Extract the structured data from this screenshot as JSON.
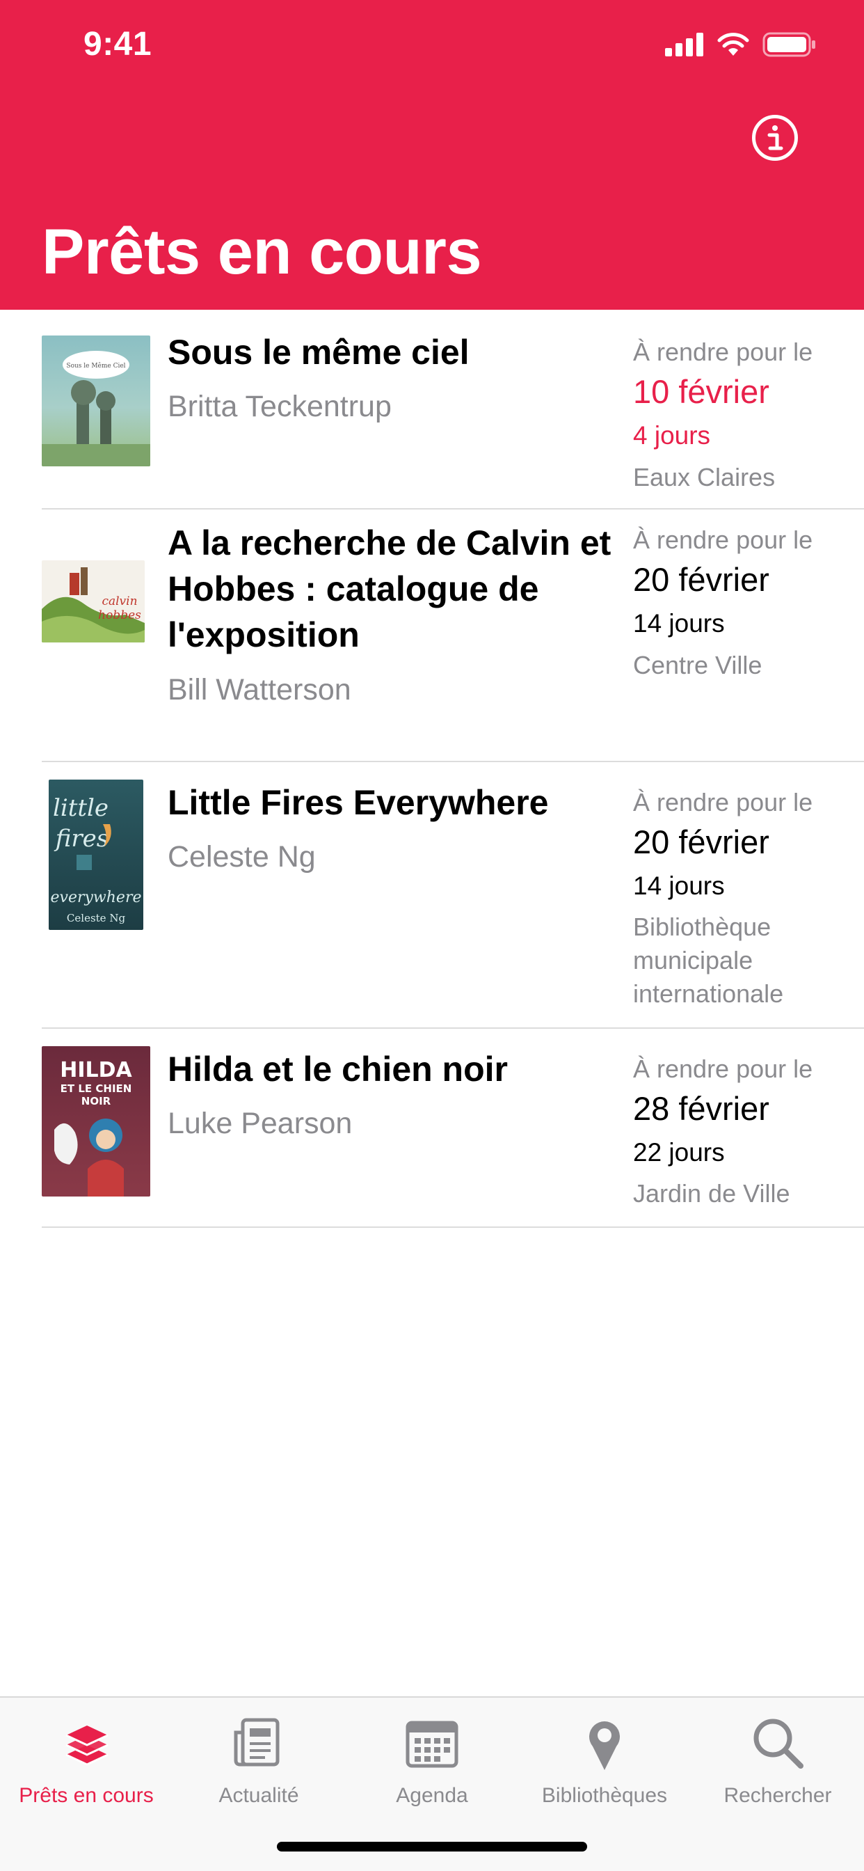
{
  "status_bar": {
    "time": "9:41"
  },
  "header": {
    "title": "Prêts en cours",
    "info_icon": "info-circle-icon"
  },
  "colors": {
    "accent": "#E8204A",
    "secondary_text": "#8a8a8e"
  },
  "loans": [
    {
      "title": "Sous le même ciel",
      "author": "Britta Teckentrup",
      "due_label": "À rendre pour le",
      "due_date": "10 février",
      "days_left": "4 jours",
      "library": "Eaux Claires",
      "urgent": true,
      "cover_text": "Sous le Même Ciel"
    },
    {
      "title": "A la recherche de Calvin et Hobbes : catalogue de l'exposition",
      "author": "Bill Watterson",
      "due_label": "À rendre pour le",
      "due_date": "20 février",
      "days_left": "14 jours",
      "library": "Centre Ville",
      "urgent": false,
      "cover_text": "calvin hobbes"
    },
    {
      "title": "Little Fires Everywhere",
      "author": "Celeste Ng",
      "due_label": "À rendre pour le",
      "due_date": "20 février",
      "days_left": "14 jours",
      "library": "Bibliothèque municipale internationale",
      "urgent": false,
      "cover_text": "little fires everywhere"
    },
    {
      "title": "Hilda et le chien noir",
      "author": "Luke Pearson",
      "due_label": "À rendre pour le",
      "due_date": "28 février",
      "days_left": "22 jours",
      "library": "Jardin de Ville",
      "urgent": false,
      "cover_text": "HILDA ET LE CHIEN NOIR"
    }
  ],
  "tabs": [
    {
      "label": "Prêts en cours",
      "icon": "books-stack-icon",
      "active": true
    },
    {
      "label": "Actualité",
      "icon": "newspaper-icon",
      "active": false
    },
    {
      "label": "Agenda",
      "icon": "calendar-icon",
      "active": false
    },
    {
      "label": "Bibliothèques",
      "icon": "map-pin-icon",
      "active": false
    },
    {
      "label": "Rechercher",
      "icon": "search-icon",
      "active": false
    }
  ]
}
